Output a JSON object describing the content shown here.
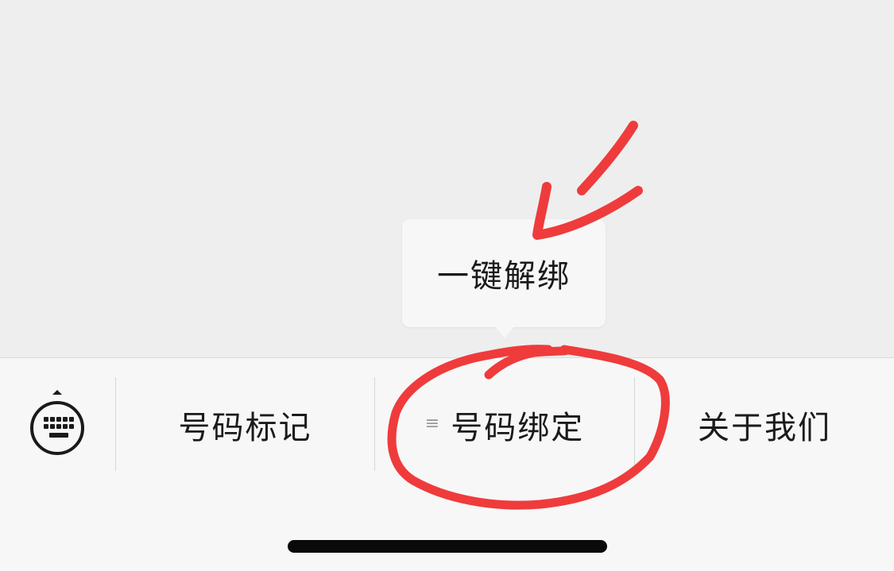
{
  "popup": {
    "label": "一键解绑"
  },
  "menu": {
    "keyboard_icon": "keyboard-toggle-icon",
    "submenu_icon_glyph": "≡",
    "items": [
      {
        "label": "号码标记"
      },
      {
        "label": "号码绑定"
      },
      {
        "label": "关于我们"
      }
    ]
  },
  "colors": {
    "annotation_red": "#ef3b3b",
    "menu_bg": "#f7f7f7",
    "content_bg": "#eeeeee"
  }
}
